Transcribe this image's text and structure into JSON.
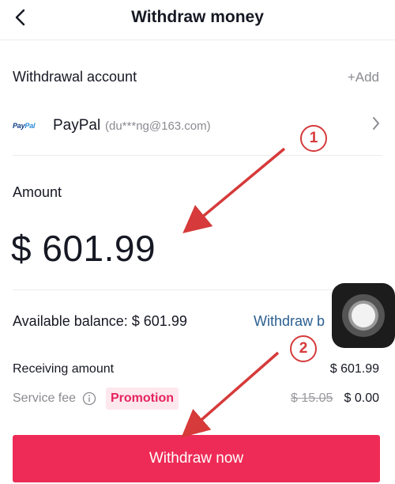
{
  "header": {
    "title": "Withdraw money",
    "back_icon": "chevron-left-icon"
  },
  "account_section": {
    "label": "Withdrawal account",
    "add_label": "+Add",
    "account": {
      "logo_text": "PayPal",
      "name": "PayPal",
      "email": "(du***ng@163.com)",
      "chevron_icon": "chevron-right-icon"
    }
  },
  "amount_section": {
    "label": "Amount",
    "value": "$ 601.99"
  },
  "balance": {
    "label": "Available balance: $ 601.99",
    "withdraw_all_label": "Withdraw b"
  },
  "receiving": {
    "label": "Receiving amount",
    "value": "$ 601.99"
  },
  "service_fee": {
    "label": "Service fee",
    "info_icon": "info-icon",
    "promo_badge": "Promotion",
    "original_fee": "$ 15.05",
    "fee": "$ 0.00"
  },
  "primary_action": {
    "label": "Withdraw now"
  },
  "annotations": {
    "step1": "1",
    "step2": "2"
  },
  "colors": {
    "accent": "#ee2b56",
    "link": "#2a5f8f",
    "promo_bg": "#fde8ee",
    "annotation": "#d63a3a"
  }
}
